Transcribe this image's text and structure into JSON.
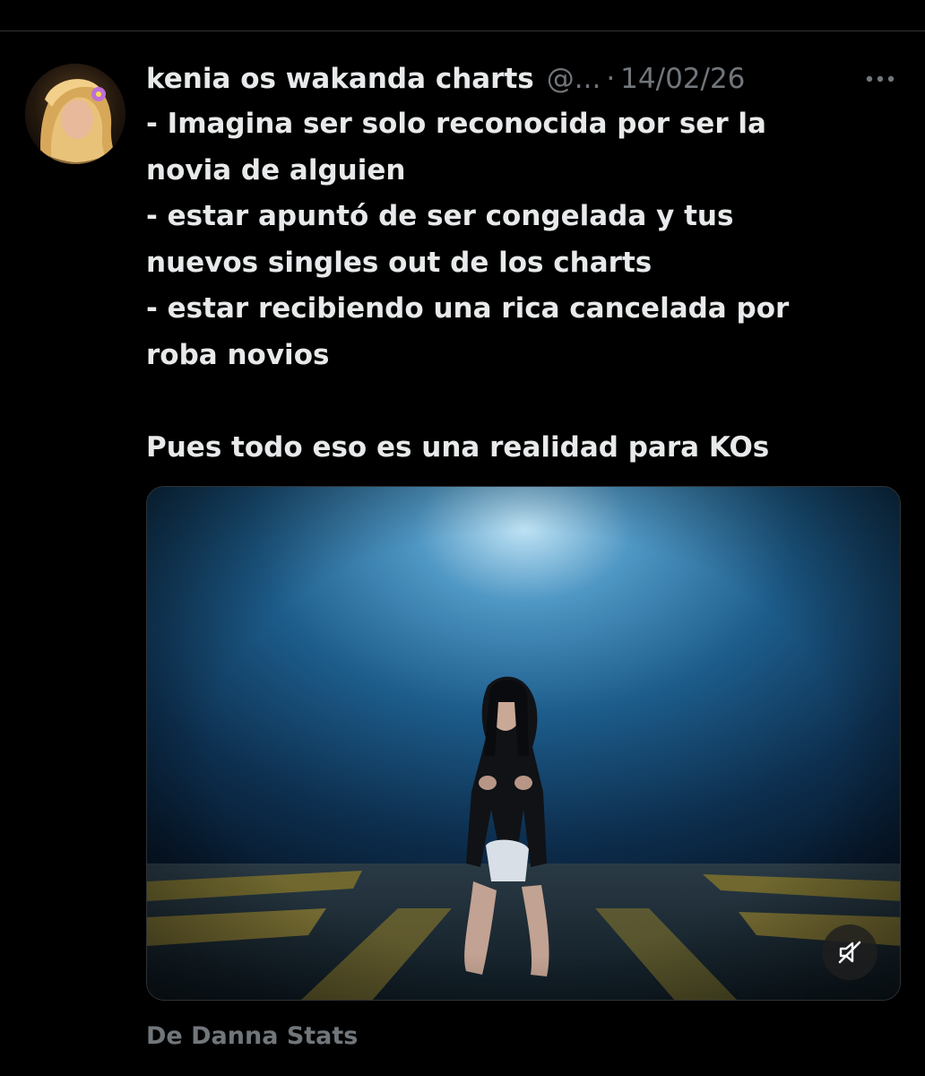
{
  "tweet": {
    "author": {
      "display_name": "kenia os wakanda charts",
      "handle": "@...",
      "avatar_icon": "profile-avatar"
    },
    "separator": "·",
    "date": "14/02/26",
    "more_icon": "more-options-icon",
    "text_lines": [
      "- Imagina ser solo reconocida por ser la",
      "novia de alguien",
      "- estar apuntó de ser congelada y tus",
      "nuevos singles out de los charts",
      "- estar recibiendo una rica cancelada por",
      "roba novios",
      "",
      "Pues todo eso es una realidad para KOs"
    ],
    "media": {
      "type": "video",
      "mute_icon": "muted-speaker-icon"
    },
    "source_attribution": "De Danna Stats"
  },
  "colors": {
    "background": "#000000",
    "primary_text": "#e7e9ea",
    "secondary_text": "#71767b",
    "divider": "#2f3336"
  }
}
